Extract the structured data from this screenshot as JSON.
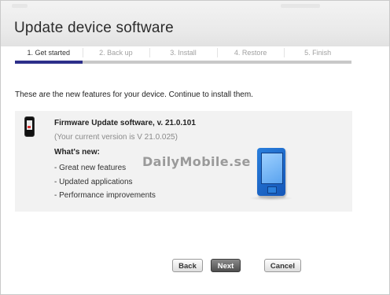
{
  "header": {
    "title": "Update device software"
  },
  "steps": [
    {
      "label": "1. Get started"
    },
    {
      "label": "2. Back up"
    },
    {
      "label": "3. Install"
    },
    {
      "label": "4. Restore"
    },
    {
      "label": "5. Finish"
    }
  ],
  "intro": "These are the new features for your device. Continue to install them.",
  "update": {
    "title": "Firmware Update software, v. 21.0.101",
    "current": "(Your current version is V 21.0.025)",
    "whats_new": "What's new:",
    "features": [
      "- Great new features",
      "- Updated applications",
      "- Performance improvements"
    ],
    "watermark": "DailyMobile.se"
  },
  "buttons": {
    "back": "Back",
    "next": "Next",
    "cancel": "Cancel"
  },
  "colors": {
    "active_step": "#2d2f8a",
    "phone": "#1f6fd1"
  }
}
